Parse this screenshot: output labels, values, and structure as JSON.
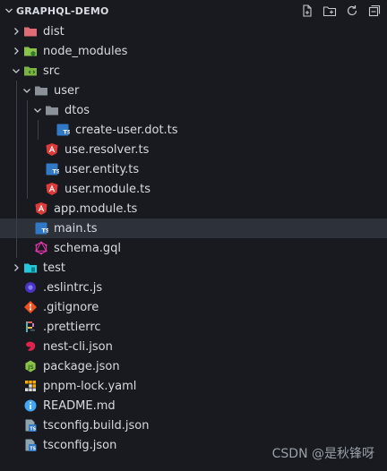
{
  "explorer": {
    "title": "GRAPHQL-DEMO",
    "actions": [
      "new-file-icon",
      "new-folder-icon",
      "refresh-icon",
      "collapse-all-icon"
    ],
    "items": [
      {
        "label": "dist",
        "depth": 0,
        "kind": "folder",
        "expanded": false,
        "icon": "folder-dist-icon"
      },
      {
        "label": "node_modules",
        "depth": 0,
        "kind": "folder",
        "expanded": false,
        "icon": "folder-node-icon"
      },
      {
        "label": "src",
        "depth": 0,
        "kind": "folder",
        "expanded": true,
        "icon": "folder-src-icon"
      },
      {
        "label": "user",
        "depth": 1,
        "kind": "folder",
        "expanded": true,
        "icon": "folder-icon"
      },
      {
        "label": "dtos",
        "depth": 2,
        "kind": "folder",
        "expanded": true,
        "icon": "folder-icon"
      },
      {
        "label": "create-user.dot.ts",
        "depth": 3,
        "kind": "file",
        "icon": "typescript-icon"
      },
      {
        "label": "use.resolver.ts",
        "depth": 2,
        "kind": "file",
        "icon": "angular-icon"
      },
      {
        "label": "user.entity.ts",
        "depth": 2,
        "kind": "file",
        "icon": "typescript-icon"
      },
      {
        "label": "user.module.ts",
        "depth": 2,
        "kind": "file",
        "icon": "angular-icon"
      },
      {
        "label": "app.module.ts",
        "depth": 1,
        "kind": "file",
        "icon": "angular-icon"
      },
      {
        "label": "main.ts",
        "depth": 1,
        "kind": "file",
        "icon": "typescript-icon",
        "selected": true
      },
      {
        "label": "schema.gql",
        "depth": 1,
        "kind": "file",
        "icon": "graphql-icon"
      },
      {
        "label": "test",
        "depth": 0,
        "kind": "folder",
        "expanded": false,
        "icon": "folder-test-icon"
      },
      {
        "label": ".eslintrc.js",
        "depth": 0,
        "kind": "file",
        "icon": "eslint-icon"
      },
      {
        "label": ".gitignore",
        "depth": 0,
        "kind": "file",
        "icon": "git-icon"
      },
      {
        "label": ".prettierrc",
        "depth": 0,
        "kind": "file",
        "icon": "prettier-icon"
      },
      {
        "label": "nest-cli.json",
        "depth": 0,
        "kind": "file",
        "icon": "nest-icon"
      },
      {
        "label": "package.json",
        "depth": 0,
        "kind": "file",
        "icon": "nodejs-icon"
      },
      {
        "label": "pnpm-lock.yaml",
        "depth": 0,
        "kind": "file",
        "icon": "pnpm-icon"
      },
      {
        "label": "README.md",
        "depth": 0,
        "kind": "file",
        "icon": "info-icon"
      },
      {
        "label": "tsconfig.build.json",
        "depth": 0,
        "kind": "file",
        "icon": "tsconfig-icon"
      },
      {
        "label": "tsconfig.json",
        "depth": 0,
        "kind": "file",
        "icon": "tsconfig-icon"
      }
    ]
  },
  "watermark": "CSDN @是秋锋呀",
  "colors": {
    "background": "#181a1f",
    "selected_row": "#2c313a",
    "text": "#d7dae0",
    "typescript": "#3178c6",
    "angular": "#dd3a3a",
    "graphql": "#e535ab",
    "folder_dist": "#e06c75",
    "folder_node": "#8bc34a",
    "folder_src": "#7cb342",
    "folder_test": "#26c6da",
    "folder": "#8a9199"
  }
}
